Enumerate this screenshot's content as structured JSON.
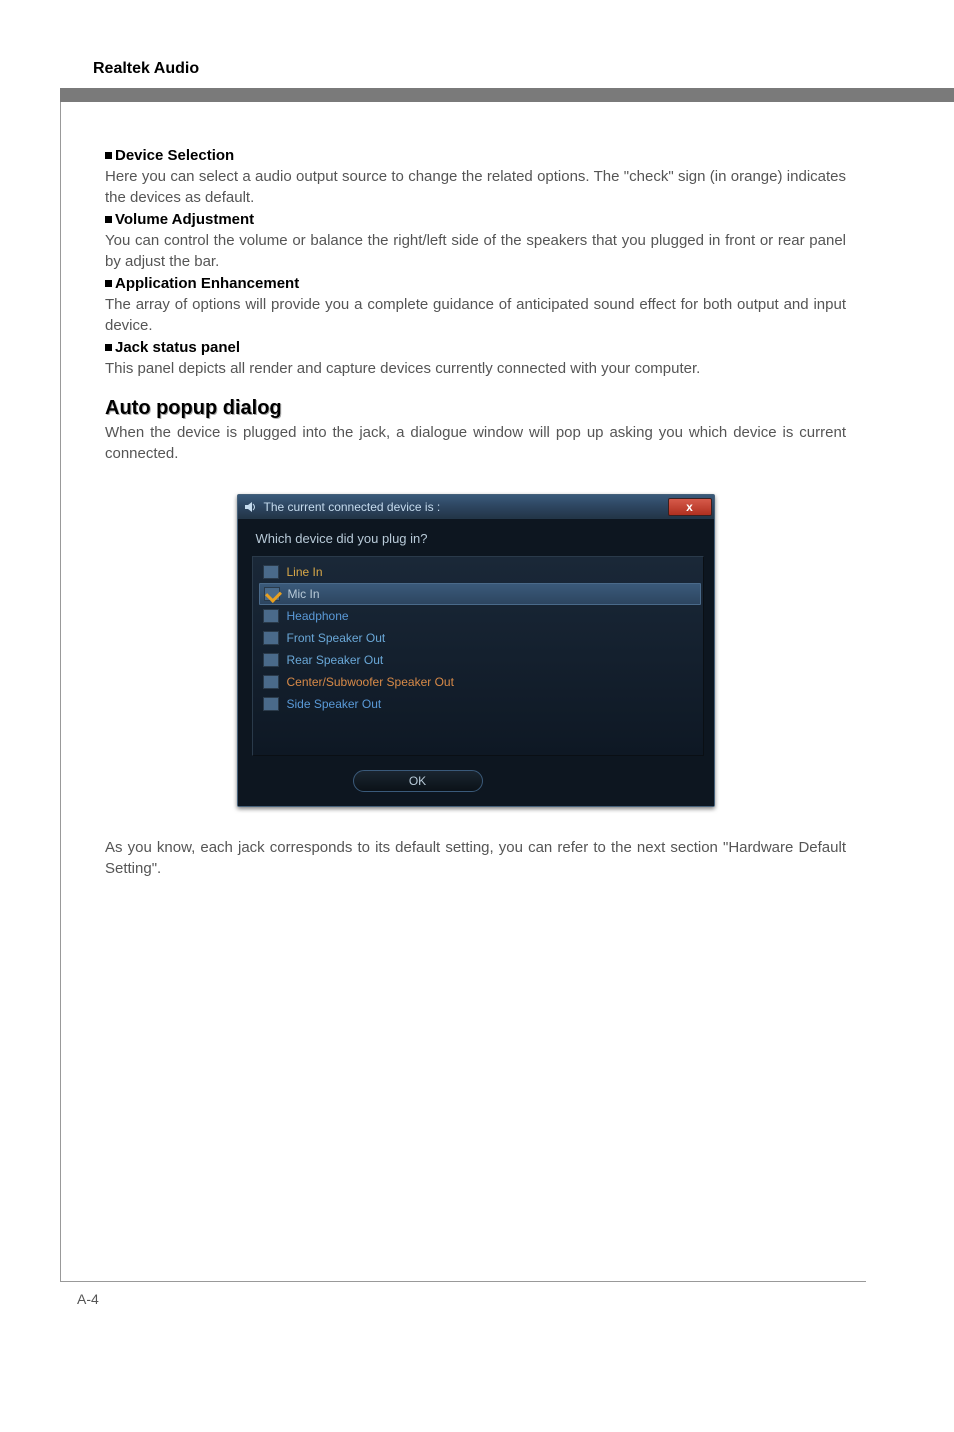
{
  "header": {
    "title": "Realtek Audio"
  },
  "sections": {
    "device_selection": {
      "heading": "Device Selection",
      "body": "Here you can select a audio output source to change the related options. The \"check\" sign (in orange) indicates the devices as default."
    },
    "volume_adjustment": {
      "heading": "Volume Adjustment",
      "body": "You can control the volume or balance the right/left side of the speakers that you plugged in front or rear panel by adjust the bar."
    },
    "application_enhancement": {
      "heading": "Application Enhancement",
      "body": "The array of options will provide you a complete guidance of anticipated sound effect for both output and input device."
    },
    "jack_status": {
      "heading": "Jack status panel",
      "body": "This panel depicts all render and capture devices currently connected with your computer."
    },
    "auto_popup": {
      "heading": "Auto popup dialog",
      "body_before": "When the device is plugged into the jack, a dialogue window will pop up asking you which device is current connected.",
      "body_after": "As you know, each jack corresponds to its default setting, you can refer to the next section \"Hardware Default Setting\"."
    }
  },
  "dialog": {
    "title": "The current connected device is :",
    "prompt": "Which device did you plug in?",
    "close_label": "x",
    "ok_label": "OK",
    "devices": [
      {
        "label": "Line In",
        "cls": "lbl-linein",
        "checked": false,
        "selected": false
      },
      {
        "label": "Mic In",
        "cls": "lbl-micin",
        "checked": true,
        "selected": true
      },
      {
        "label": "Headphone",
        "cls": "lbl-headphone",
        "checked": false,
        "selected": false
      },
      {
        "label": "Front Speaker Out",
        "cls": "lbl-front",
        "checked": false,
        "selected": false
      },
      {
        "label": "Rear Speaker Out",
        "cls": "lbl-rear",
        "checked": false,
        "selected": false
      },
      {
        "label": "Center/Subwoofer Speaker Out",
        "cls": "lbl-center",
        "checked": false,
        "selected": false
      },
      {
        "label": "Side Speaker Out",
        "cls": "lbl-side",
        "checked": false,
        "selected": false
      }
    ]
  },
  "footer": {
    "page": "A-4"
  }
}
